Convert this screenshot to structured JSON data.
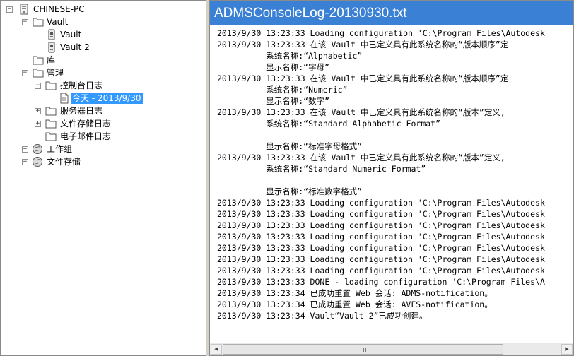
{
  "tree": {
    "computer_label": "CHINESE-PC",
    "vault_label": "Vault",
    "vault_child_1": "Vault",
    "vault_child_2": "Vault 2",
    "library_label": "库",
    "manage_label": "管理",
    "console_log_label": "控制台日志",
    "today_label": "今天 - 2013/9/30",
    "server_log_label": "服务器日志",
    "filestore_log_label": "文件存储日志",
    "email_log_label": "电子邮件日志",
    "workgroup_label": "工作组",
    "filestore_label": "文件存储"
  },
  "log": {
    "title": "ADMSConsoleLog-20130930.txt",
    "lines": [
      "2013/9/30 13:23:33 Loading configuration 'C:\\Program Files\\Autodesk",
      "2013/9/30 13:23:33 在该 Vault 中已定义具有此系统名称的“版本顺序”定",
      "          系统名称:“Alphabetic”",
      "          显示名称:“字母”",
      "2013/9/30 13:23:33 在该 Vault 中已定义具有此系统名称的“版本顺序”定",
      "          系统名称:“Numeric”",
      "          显示名称:“数字”",
      "2013/9/30 13:23:33 在该 Vault 中已定义具有此系统名称的“版本”定义,",
      "          系统名称:“Standard Alphabetic Format”",
      "",
      "          显示名称:“标准字母格式”",
      "2013/9/30 13:23:33 在该 Vault 中已定义具有此系统名称的“版本”定义,",
      "          系统名称:“Standard Numeric Format”",
      "",
      "          显示名称:“标准数字格式”",
      "2013/9/30 13:23:33 Loading configuration 'C:\\Program Files\\Autodesk",
      "2013/9/30 13:23:33 Loading configuration 'C:\\Program Files\\Autodesk",
      "2013/9/30 13:23:33 Loading configuration 'C:\\Program Files\\Autodesk",
      "2013/9/30 13:23:33 Loading configuration 'C:\\Program Files\\Autodesk",
      "2013/9/30 13:23:33 Loading configuration 'C:\\Program Files\\Autodesk",
      "2013/9/30 13:23:33 Loading configuration 'C:\\Program Files\\Autodesk",
      "2013/9/30 13:23:33 Loading configuration 'C:\\Program Files\\Autodesk",
      "2013/9/30 13:23:33 DONE - loading configuration 'C:\\Program Files\\A",
      "2013/9/30 13:23:34 已成功重置 Web 会话: ADMS-notification。",
      "2013/9/30 13:23:34 已成功重置 Web 会话: AVFS-notification。",
      "2013/9/30 13:23:34 Vault“Vault 2”已成功创建。"
    ]
  },
  "scrollbar": {
    "left_arrow": "◀",
    "right_arrow": "▶",
    "thumb_fraction": 0.83
  }
}
